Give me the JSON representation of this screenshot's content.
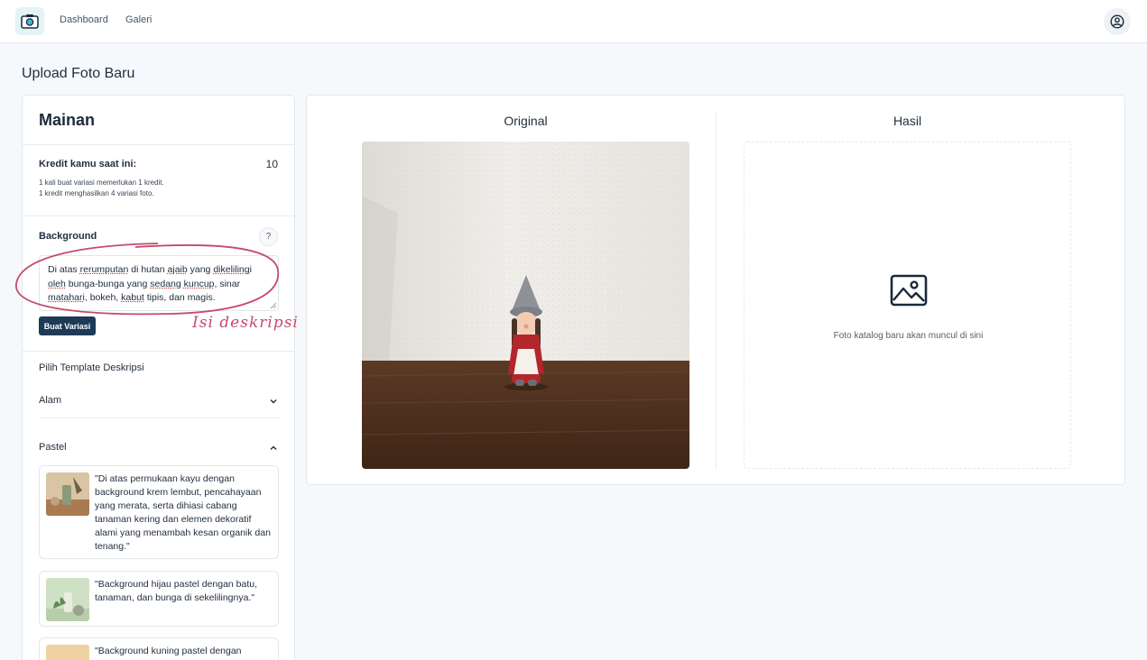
{
  "nav": {
    "links": [
      "Dashboard",
      "Galeri"
    ]
  },
  "page": {
    "title": "Upload Foto Baru"
  },
  "left": {
    "title": "Mainan",
    "credit_label": "Kredit kamu saat ini:",
    "credit_value": "10",
    "credit_notes": [
      "1 kali buat variasi memerlukan 1 kredit.",
      "1 kredit menghasilkan 4 variasi foto."
    ],
    "background_label": "Background",
    "help_label": "?",
    "description_parts": [
      "Di atas ",
      "rerumputan",
      " di hutan ",
      "ajaib",
      " yang ",
      "dikelilingi",
      " ",
      "oleh",
      " bunga-bunga yang ",
      "sedang",
      " ",
      "kuncup",
      ", sinar ",
      "matahari",
      ", bokeh, ",
      "kabut",
      " tipis, dan magis."
    ],
    "generate_button": "Buat Variasi",
    "template_label": "Pilih Template Deskripsi",
    "accordions": [
      {
        "label": "Alam",
        "expanded": false
      },
      {
        "label": "Pastel",
        "expanded": true
      }
    ],
    "templates": [
      "\"Di atas permukaan kayu dengan background krem lembut, pencahayaan yang merata, serta dihiasi cabang tanaman kering dan elemen dekoratif alami yang menambah kesan organik dan tenang.\"",
      "\"Background hijau pastel dengan batu, tanaman, dan bunga di sekelilingnya.\"",
      "\"Background kuning pastel dengan"
    ]
  },
  "right": {
    "original_title": "Original",
    "result_title": "Hasil",
    "result_placeholder": "Foto katalog baru akan muncul di sini"
  },
  "annotation": {
    "text": "Isi deskripsi",
    "color": "#c64b6b"
  },
  "colors": {
    "primary": "#1d3a57",
    "background": "#f6f9fc",
    "annotation": "#c64b6b"
  }
}
